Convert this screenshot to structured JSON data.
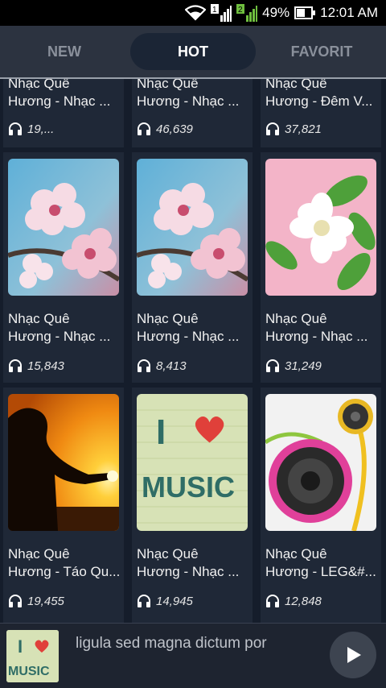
{
  "status": {
    "battery": "49%",
    "time": "12:01 AM",
    "sim1": "1",
    "sim2": "2"
  },
  "tabs": [
    {
      "label": "NEW",
      "active": false
    },
    {
      "label": "HOT",
      "active": true
    },
    {
      "label": "FAVORIT",
      "active": false
    }
  ],
  "songs": [
    {
      "title1": "Nhạc Quê",
      "title2": "Hương - Nhạc ...",
      "plays": "19,..."
    },
    {
      "title1": "Nhạc Quê",
      "title2": "Hương - Nhạc ...",
      "plays": "46,639"
    },
    {
      "title1": "Nhạc Quê",
      "title2": "Hương - Đêm V...",
      "plays": "37,821"
    },
    {
      "title1": "Nhạc Quê",
      "title2": "Hương - Nhạc ...",
      "plays": "15,843"
    },
    {
      "title1": "Nhạc Quê",
      "title2": "Hương - Nhạc ...",
      "plays": "8,413"
    },
    {
      "title1": "Nhạc Quê",
      "title2": "Hương - Nhạc ...",
      "plays": "31,249"
    },
    {
      "title1": "Nhạc Quê",
      "title2": "Hương - Táo Qu...",
      "plays": "19,455"
    },
    {
      "title1": "Nhạc Quê",
      "title2": "Hương - Nhạc ...",
      "plays": "14,945"
    },
    {
      "title1": "Nhạc Quê",
      "title2": "Hương - LEG&#...",
      "plays": "12,848"
    }
  ],
  "thumb_words": {
    "i": "I",
    "music": "MUSIC"
  },
  "player": {
    "now_playing": "ligula sed magna dictum por"
  }
}
